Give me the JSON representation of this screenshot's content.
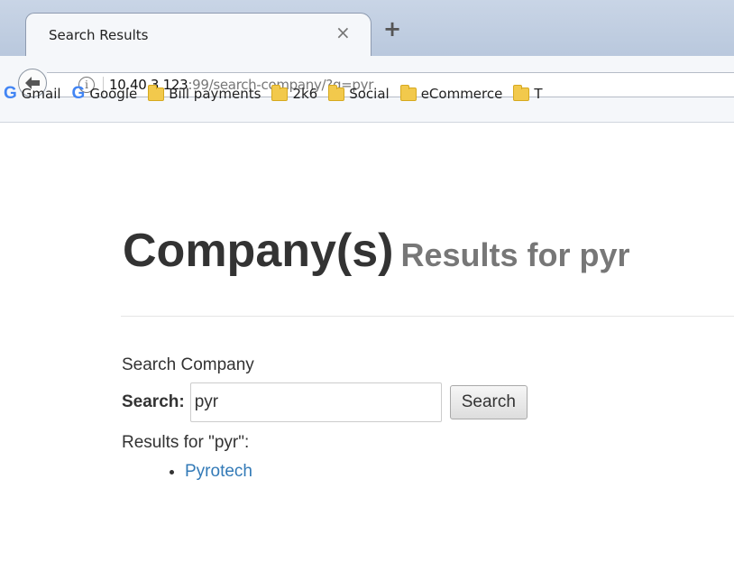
{
  "browser": {
    "tab_title": "Search Results",
    "tab_close": "×",
    "new_tab": "+",
    "url_host": "10.40.3.123",
    "url_rest": ":99/search-company/?q=pyr",
    "info_icon": "i",
    "back_icon": "back-arrow-icon"
  },
  "bookmarks": [
    {
      "icon": "google-g-icon",
      "label": "Gmail"
    },
    {
      "icon": "google-g-icon",
      "label": "Google"
    },
    {
      "icon": "folder-icon",
      "label": "Bill payments"
    },
    {
      "icon": "folder-icon",
      "label": "2k6"
    },
    {
      "icon": "folder-icon",
      "label": "Social"
    },
    {
      "icon": "folder-icon",
      "label": "eCommerce"
    },
    {
      "icon": "folder-icon",
      "label": "T"
    }
  ],
  "page": {
    "title": "Company(s)",
    "subtitle": "Results for pyr",
    "search_section_title": "Search Company",
    "search_label": "Search:",
    "search_value": "pyr",
    "search_button": "Search",
    "results_label": "Results for \"pyr\":",
    "results": [
      "Pyrotech"
    ]
  },
  "colors": {
    "link": "#337ab7",
    "heading": "#333333",
    "subheading": "#777777"
  }
}
